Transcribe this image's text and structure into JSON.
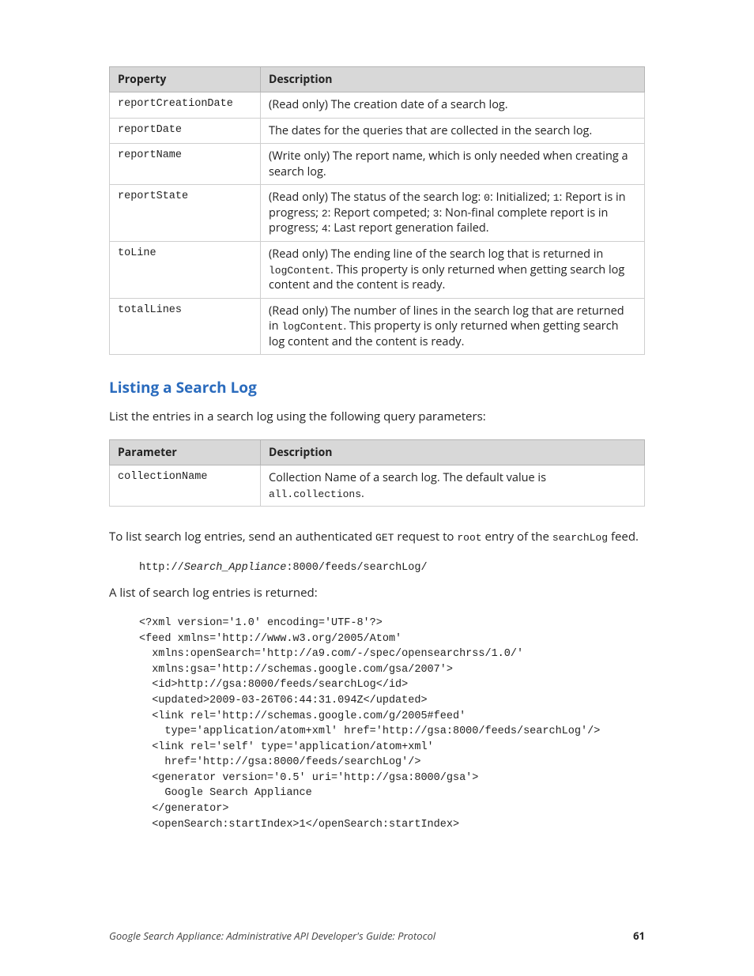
{
  "table1": {
    "headers": [
      "Property",
      "Description"
    ],
    "rows": [
      {
        "prop": "reportCreationDate",
        "desc_pre": "(Read only) The creation date of a search log."
      },
      {
        "prop": "reportDate",
        "desc_pre": "The dates for the queries that are collected in the search log."
      },
      {
        "prop": "reportName",
        "desc_pre": "(Write only) The report name, which is only needed when creating a search log."
      },
      {
        "prop": "reportState",
        "desc_parts": [
          "(Read only) The status of the search log: ",
          "0",
          ": Initialized; ",
          "1",
          ": Report is in progress; ",
          "2",
          ": Report competed; ",
          "3",
          ": Non-final complete report is in progress; ",
          "4",
          ": Last report generation failed."
        ]
      },
      {
        "prop": "toLine",
        "desc_parts": [
          "(Read only) The ending line of the search log that is returned in ",
          "logContent",
          ". This property is only returned when getting search log content and the content is ready."
        ]
      },
      {
        "prop": "totalLines",
        "desc_parts": [
          "(Read only) The number of lines in the search log that are returned in ",
          "logContent",
          ". This property is only returned when getting search log content and the content is ready."
        ]
      }
    ]
  },
  "section_heading": "Listing a Search Log",
  "para1": "List the entries in a search log using the following query parameters:",
  "table2": {
    "headers": [
      "Parameter",
      "Description"
    ],
    "row": {
      "prop": "collectionName",
      "desc_pre": "Collection Name of a search log. The default value is ",
      "desc_code": "all.collections",
      "desc_post": "."
    }
  },
  "para2": {
    "pre": "To list search log entries, send an authenticated ",
    "c1": "GET",
    "mid": " request to ",
    "c2": "root",
    "mid2": " entry of the ",
    "c3": "searchLog",
    "post": " feed."
  },
  "code1": {
    "pre": "http://",
    "ital": "Search_Appliance",
    "post": ":8000/feeds/searchLog/"
  },
  "para3": "A list of search log entries is returned:",
  "code2": "<?xml version='1.0' encoding='UTF-8'?>\n<feed xmlns='http://www.w3.org/2005/Atom'\n  xmlns:openSearch='http://a9.com/-/spec/opensearchrss/1.0/'\n  xmlns:gsa='http://schemas.google.com/gsa/2007'>\n  <id>http://gsa:8000/feeds/searchLog</id>\n  <updated>2009-03-26T06:44:31.094Z</updated>\n  <link rel='http://schemas.google.com/g/2005#feed'\n    type='application/atom+xml' href='http://gsa:8000/feeds/searchLog'/>\n  <link rel='self' type='application/atom+xml'\n    href='http://gsa:8000/feeds/searchLog'/>\n  <generator version='0.5' uri='http://gsa:8000/gsa'>\n    Google Search Appliance\n  </generator>\n  <openSearch:startIndex>1</openSearch:startIndex>",
  "footer": {
    "title": "Google Search Appliance: Administrative API Developer's Guide: Protocol",
    "page": "61"
  }
}
